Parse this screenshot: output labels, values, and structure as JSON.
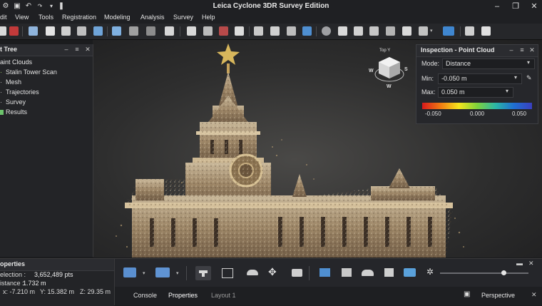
{
  "window": {
    "title": "Leica Cyclone 3DR Survey Edition"
  },
  "menu": [
    "dit",
    "View",
    "Tools",
    "Registration",
    "Modeling",
    "Analysis",
    "Survey",
    "Help"
  ],
  "tree": {
    "title": "t Tree",
    "root": "aint Clouds",
    "items": [
      "Stalin Tower Scan",
      "Mesh",
      "Trajectories",
      "Survey",
      "Results"
    ]
  },
  "inspection": {
    "title": "Inspection - Point Cloud",
    "mode_label": "Mode:",
    "mode_value": "Distance",
    "min_label": "Min:",
    "min_value": "-0.050 m",
    "max_label": "Max:",
    "max_value": "0.050 m",
    "scale_min": "-0.050",
    "scale_mid": "0.000",
    "scale_max": "0.050"
  },
  "navcube": {
    "top": "Top Y",
    "w": "W",
    "s": "S",
    "n": "W"
  },
  "properties": {
    "title": "operties",
    "selection_label": "election :",
    "selection_value": "3,652,489 pts",
    "distance_label": "istance :",
    "distance_value": "1.732 m",
    "x": "x: -7.210 m",
    "y": "Y: 15.382 m",
    "z": "Z: 29.35 m"
  },
  "bottom_tabs": {
    "console": "Console",
    "properties": "Properties",
    "layout": "Layout 1",
    "view_mode": "Perspective"
  },
  "slider_level": 0.72,
  "colors": {
    "accent": "#1e88e5",
    "panel": "#26272b",
    "bg": "#1b1c1e"
  }
}
